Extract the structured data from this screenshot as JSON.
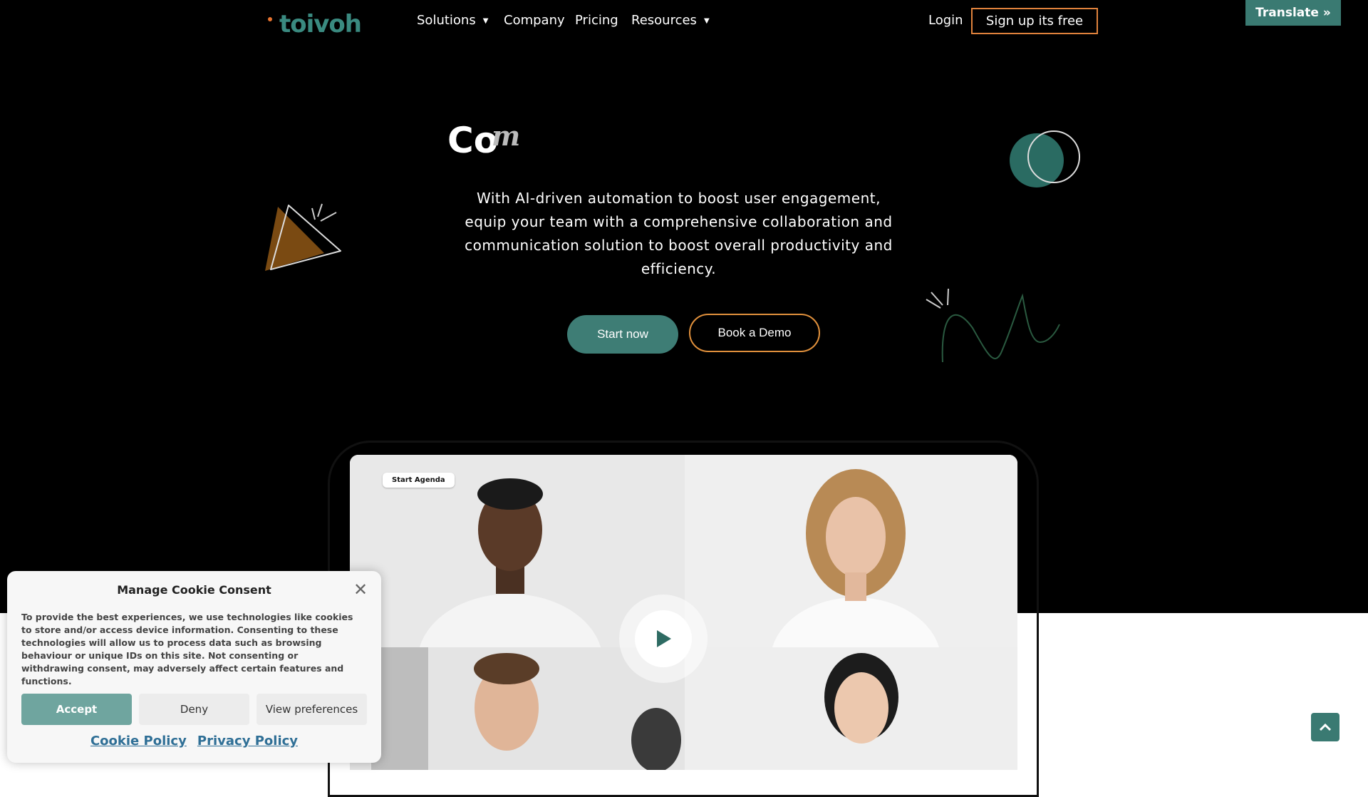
{
  "header": {
    "logo_text": "toivoh",
    "nav": [
      {
        "label": "Solutions",
        "has_dropdown": true
      },
      {
        "label": "Company",
        "has_dropdown": false
      },
      {
        "label": "Pricing",
        "has_dropdown": false
      },
      {
        "label": "Resources",
        "has_dropdown": true
      }
    ],
    "login_label": "Login",
    "signup_label": "Sign up its free",
    "translate_label": "Translate »"
  },
  "hero": {
    "headline_visible": "Co",
    "headline_animating": "m",
    "description": "With AI-driven automation to boost user engagement, equip your team with a comprehensive collaboration and communication solution to boost overall productivity and efficiency.",
    "start_button": "Start now",
    "demo_button": "Book a Demo"
  },
  "video_preview": {
    "agenda_tag": "Start Agenda",
    "play_icon": "play-icon"
  },
  "cookie_banner": {
    "title": "Manage Cookie Consent",
    "text": "To provide the best experiences, we use technologies like cookies to store and/or access device information. Consenting to these technologies will allow us to process data such as browsing behaviour or unique IDs on this site. Not consenting or withdrawing consent, may adversely affect certain features and functions.",
    "accept_label": "Accept",
    "deny_label": "Deny",
    "preferences_label": "View preferences",
    "cookie_policy_label": "Cookie Policy",
    "privacy_policy_label": "Privacy Policy",
    "close_icon": "close-icon"
  },
  "colors": {
    "brand_teal": "#3a7a72",
    "accent_orange": "#e0823c",
    "hero_background": "#000000"
  }
}
